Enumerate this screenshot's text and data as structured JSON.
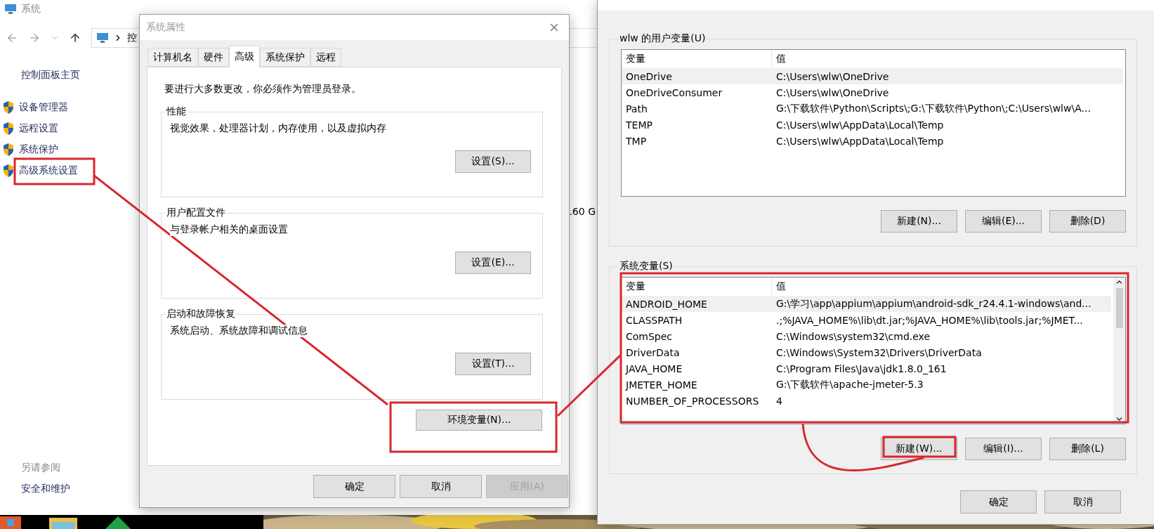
{
  "control_panel": {
    "title": "系统",
    "address": "控",
    "home_link": "控制面板主页",
    "tasks": [
      {
        "label": "设备管理器"
      },
      {
        "label": "远程设置"
      },
      {
        "label": "系统保护"
      },
      {
        "label": "高级系统设置"
      }
    ],
    "partial_text": ".60 G",
    "see_also": {
      "heading": "另请参阅",
      "links": [
        "安全和维护"
      ]
    }
  },
  "system_properties": {
    "title": "系统属性",
    "tabs": [
      {
        "label": "计算机名",
        "selected": false
      },
      {
        "label": "硬件",
        "selected": false
      },
      {
        "label": "高级",
        "selected": true
      },
      {
        "label": "系统保护",
        "selected": false
      },
      {
        "label": "远程",
        "selected": false
      }
    ],
    "admin_note": "要进行大多数更改，你必须作为管理员登录。",
    "groups": [
      {
        "title": "性能",
        "description": "视觉效果，处理器计划，内存使用，以及虚拟内存",
        "button": "设置(S)..."
      },
      {
        "title": "用户配置文件",
        "description": "与登录帐户相关的桌面设置",
        "button": "设置(E)..."
      },
      {
        "title": "启动和故障恢复",
        "description": "系统启动、系统故障和调试信息",
        "button": "设置(T)..."
      }
    ],
    "env_button": "环境变量(N)...",
    "buttons": [
      {
        "label": "确定",
        "disabled": false
      },
      {
        "label": "取消",
        "disabled": false
      },
      {
        "label": "应用(A)",
        "disabled": true
      }
    ]
  },
  "environment_variables": {
    "user_vars": {
      "title": "wlw 的用户变量(U)",
      "scrollbar": false,
      "columns": [
        "变量",
        "值"
      ],
      "rows": [
        {
          "name": "OneDrive",
          "value": "C:\\Users\\wlw\\OneDrive",
          "selected": true
        },
        {
          "name": "OneDriveConsumer",
          "value": "C:\\Users\\wlw\\OneDrive",
          "selected": false
        },
        {
          "name": "Path",
          "value": "G:\\下载软件\\Python\\Scripts\\;G:\\下载软件\\Python\\;C:\\Users\\wlw\\A...",
          "selected": false
        },
        {
          "name": "TEMP",
          "value": "C:\\Users\\wlw\\AppData\\Local\\Temp",
          "selected": false
        },
        {
          "name": "TMP",
          "value": "C:\\Users\\wlw\\AppData\\Local\\Temp",
          "selected": false
        }
      ],
      "buttons": [
        "新建(N)...",
        "编辑(E)...",
        "删除(D)"
      ]
    },
    "system_vars": {
      "title": "系统变量(S)",
      "scrollbar": true,
      "columns": [
        "变量",
        "值"
      ],
      "rows": [
        {
          "name": "ANDROID_HOME",
          "value": "G:\\学习\\app\\appium\\appium\\android-sdk_r24.4.1-windows\\and...",
          "selected": true
        },
        {
          "name": "CLASSPATH",
          "value": ".;%JAVA_HOME%\\lib\\dt.jar;%JAVA_HOME%\\lib\\tools.jar;%JMET...",
          "selected": false
        },
        {
          "name": "ComSpec",
          "value": "C:\\Windows\\system32\\cmd.exe",
          "selected": false
        },
        {
          "name": "DriverData",
          "value": "C:\\Windows\\System32\\Drivers\\DriverData",
          "selected": false
        },
        {
          "name": "JAVA_HOME",
          "value": "C:\\Program Files\\Java\\jdk1.8.0_161",
          "selected": false
        },
        {
          "name": "JMETER_HOME",
          "value": "G:\\下载软件\\apache-jmeter-5.3",
          "selected": false
        },
        {
          "name": "NUMBER_OF_PROCESSORS",
          "value": "4",
          "selected": false
        }
      ],
      "buttons": [
        "新建(W)...",
        "编辑(I)...",
        "删除(L)"
      ]
    },
    "buttons": [
      "确定",
      "取消"
    ]
  }
}
